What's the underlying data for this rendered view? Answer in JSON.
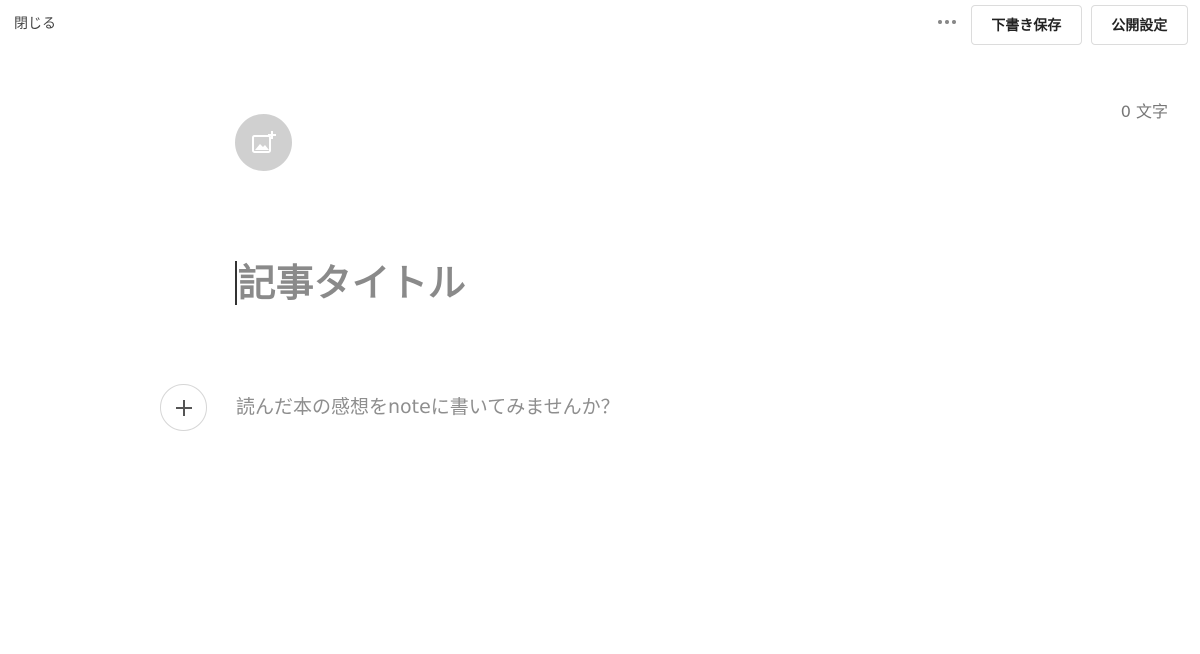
{
  "header": {
    "close_label": "閉じる",
    "more_icon": "more-horizontal-icon",
    "save_draft_label": "下書き保存",
    "publish_settings_label": "公開設定"
  },
  "editor": {
    "char_count": "0 文字",
    "header_image_icon": "add-image-icon",
    "title_placeholder": "記事タイトル",
    "add_block_icon": "plus-icon",
    "body_placeholder": "読んだ本の感想をnoteに書いてみませんか？"
  },
  "colors": {
    "background": "#ffffff",
    "placeholder": "#8a8a8a",
    "image_button_bg": "#d0d0d0",
    "border": "#dcdcdc"
  }
}
